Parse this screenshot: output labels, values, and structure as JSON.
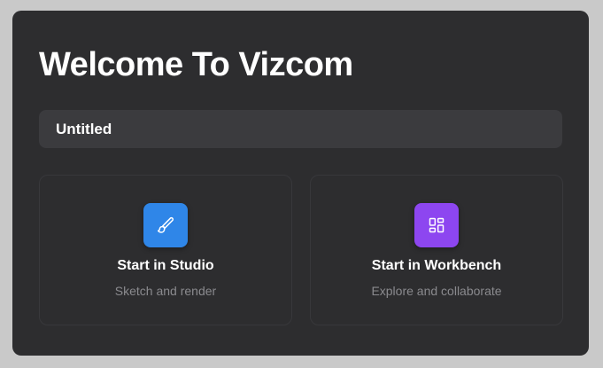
{
  "dialog": {
    "title": "Welcome To Vizcom",
    "name_input": {
      "value": "Untitled"
    },
    "cards": [
      {
        "id": "studio",
        "title": "Start in Studio",
        "subtitle": "Sketch and render",
        "icon": "paintbrush-icon",
        "icon_color": "#2f86e8"
      },
      {
        "id": "workbench",
        "title": "Start in Workbench",
        "subtitle": "Explore and collaborate",
        "icon": "layout-dashboard-icon",
        "icon_color": "#8d46f0"
      }
    ]
  },
  "colors": {
    "background": "#c9c9c9",
    "dialog": "#2d2d2f",
    "input": "#3b3b3e",
    "subtitle": "#8a8a8e"
  }
}
